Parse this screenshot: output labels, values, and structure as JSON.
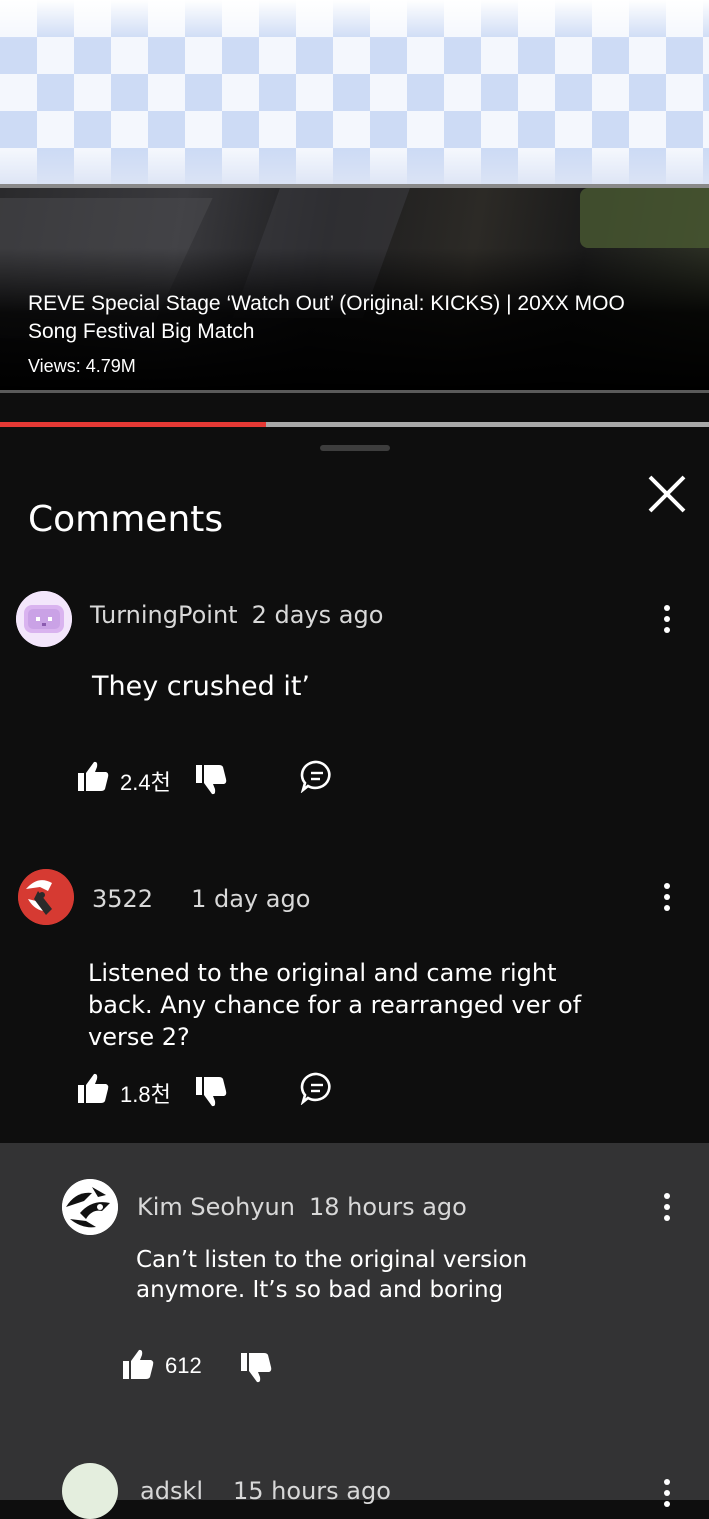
{
  "video": {
    "title": "REVE Special Stage ‘Watch Out’ (Original: KICKS) | 20XX MOO Song Festival Big Match",
    "views": "Views: 4.79M",
    "progress_fraction": 0.375
  },
  "sheet": {
    "title": "Comments"
  },
  "comments": [
    {
      "author": "TurningPoint",
      "time": "2 days ago",
      "text": "They crushed it’",
      "likes": "2.4천"
    },
    {
      "author": "3522",
      "time": "1 day ago",
      "text": "Listened to the original and came right back. Any chance for a rearranged ver of verse 2?",
      "likes": "1.8천"
    }
  ],
  "replies": [
    {
      "author": "Kim Seohyun",
      "time": "18 hours ago",
      "text": "Can’t listen to the original version anymore. It’s so bad and boring",
      "likes": "612"
    },
    {
      "author": "adskl",
      "time": "15 hours ago"
    }
  ],
  "colors": {
    "accent_red": "#e53935",
    "sheet_bg": "#0e0e0e",
    "reply_bg": "#333334"
  },
  "icons": [
    "close-icon",
    "more-vertical-icon",
    "thumbs-up-icon",
    "thumbs-down-icon",
    "reply-comment-icon"
  ]
}
